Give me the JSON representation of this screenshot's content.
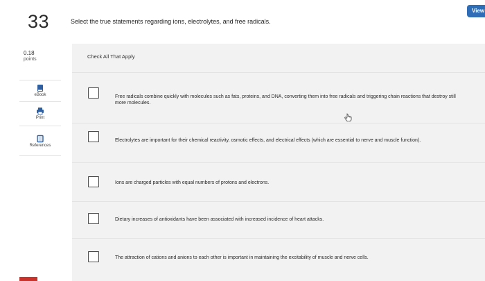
{
  "question": {
    "number": "33",
    "prompt": "Select the true statements regarding ions, electrolytes, and free radicals.",
    "points_value": "0.18",
    "points_label": "points",
    "instruction": "Check All That Apply"
  },
  "header": {
    "view_label": "View"
  },
  "tools": [
    {
      "label": "eBook",
      "icon": "book-icon"
    },
    {
      "label": "Print",
      "icon": "printer-icon"
    },
    {
      "label": "References",
      "icon": "references-icon"
    }
  ],
  "options": [
    {
      "text": "Free radicals combine quickly with molecules such as fats, proteins, and DNA, converting them into free radicals and triggering chain reactions that destroy still more molecules.",
      "checked": false
    },
    {
      "text": "Electrolytes are important for their chemical reactivity, osmotic effects, and electrical effects (which are essential to nerve and muscle function).",
      "checked": false
    },
    {
      "text": "Ions are charged particles with equal numbers of protons and electrons.",
      "checked": false
    },
    {
      "text": "Dietary increases of antioxidants have been associated with increased incidence of heart attacks.",
      "checked": false
    },
    {
      "text": "The attraction of cations and anions to each other is important in maintaining the excitability of muscle and nerve cells.",
      "checked": false
    }
  ],
  "colors": {
    "panel_bg": "#f2f2f2",
    "view_button": "#2f6eb6",
    "brand_red": "#c8342c"
  }
}
